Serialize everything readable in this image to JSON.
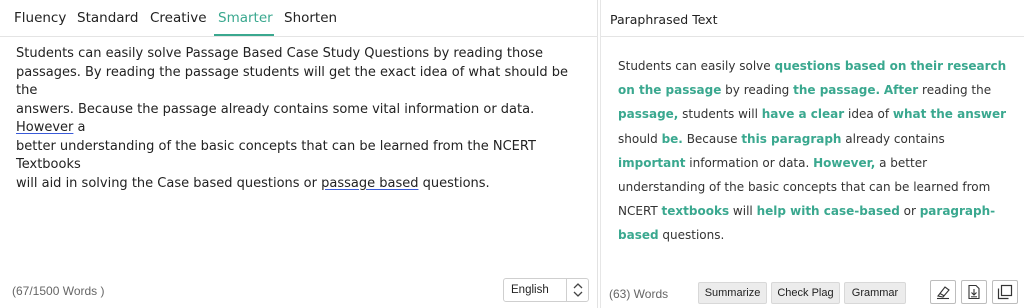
{
  "tabs": [
    {
      "label": "Fluency",
      "active": false
    },
    {
      "label": "Standard",
      "active": false
    },
    {
      "label": "Creative",
      "active": false
    },
    {
      "label": "Smarter",
      "active": true
    },
    {
      "label": "Shorten",
      "active": false
    }
  ],
  "input": {
    "line1": "Students can easily solve Passage Based Case Study Questions by reading those",
    "line2": "passages. By reading the passage students will get the exact idea of what should be the",
    "line3a": "answers. Because the passage already contains some vital information or data. ",
    "line3b": "However",
    "line3c": " a",
    "line4": "better understanding of the basic concepts that can be learned from the NCERT Textbooks",
    "line5a": "will aid in solving the Case based questions or ",
    "line5b": "passage based",
    "line5c": " questions."
  },
  "word_count_left": "(67/1500 Words )",
  "language": {
    "selected": "English"
  },
  "output": {
    "title": "Paraphrased Text",
    "segments": [
      {
        "text": "Students can easily solve ",
        "highlight": false
      },
      {
        "text": "questions based on their research on the passage",
        "highlight": true
      },
      {
        "text": " by reading ",
        "highlight": false
      },
      {
        "text": "the passage.",
        "highlight": true
      },
      {
        "text": " ",
        "highlight": false
      },
      {
        "text": "After",
        "highlight": true
      },
      {
        "text": " reading the ",
        "highlight": false
      },
      {
        "text": "passage,",
        "highlight": true
      },
      {
        "text": " students will ",
        "highlight": false
      },
      {
        "text": "have a clear",
        "highlight": true
      },
      {
        "text": " idea of ",
        "highlight": false
      },
      {
        "text": "what the answer",
        "highlight": true
      },
      {
        "text": " should ",
        "highlight": false
      },
      {
        "text": "be.",
        "highlight": true
      },
      {
        "text": " Because ",
        "highlight": false
      },
      {
        "text": "this paragraph",
        "highlight": true
      },
      {
        "text": " already contains ",
        "highlight": false
      },
      {
        "text": "important",
        "highlight": true
      },
      {
        "text": " information or data. ",
        "highlight": false
      },
      {
        "text": "However,",
        "highlight": true
      },
      {
        "text": " a better understanding of the basic concepts that can be learned from NCERT ",
        "highlight": false
      },
      {
        "text": "textbooks",
        "highlight": true
      },
      {
        "text": " will ",
        "highlight": false
      },
      {
        "text": "help with case-based",
        "highlight": true
      },
      {
        "text": " or ",
        "highlight": false
      },
      {
        "text": "paragraph-based",
        "highlight": true
      },
      {
        "text": " questions.",
        "highlight": false
      }
    ]
  },
  "word_count_right": "(63) Words",
  "actions": {
    "summarize": "Summarize",
    "check_plag": "Check Plag",
    "grammar": "Grammar"
  },
  "icons": {
    "eraser": "eraser-icon",
    "download": "download-icon",
    "copy": "copy-icon"
  },
  "colors": {
    "accent": "#3aa88f",
    "underline_blue": "#3a5bd9"
  }
}
